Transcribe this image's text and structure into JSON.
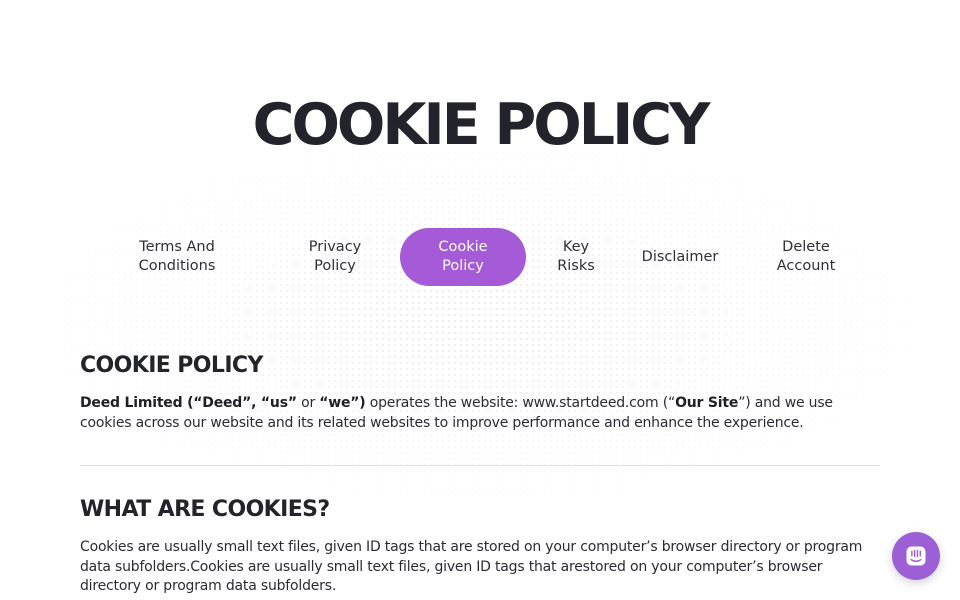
{
  "hero": {
    "title": "COOKIE POLICY"
  },
  "tabs": [
    {
      "label": "Terms And\nConditions",
      "active": false
    },
    {
      "label": "Privacy\nPolicy",
      "active": false
    },
    {
      "label": "Cookie\nPolicy",
      "active": true
    },
    {
      "label": "Key\nRisks",
      "active": false
    },
    {
      "label": "Disclaimer",
      "active": false
    },
    {
      "label": "Delete\nAccount",
      "active": false
    }
  ],
  "sections": {
    "cookie_policy": {
      "heading": "COOKIE POLICY",
      "company": "Deed Limited (“Deed”, “us”",
      "or_word": " or ",
      "we": "“we”)",
      "intro": " operates the website: www.startdeed.com (“",
      "our_site": "Our Site",
      "rest": "”) and we use cookies across our website and its related websites to improve performance and enhance the experience."
    },
    "what_are_cookies": {
      "heading": "WHAT ARE COOKIES?",
      "body": "Cookies are usually small text files, given ID tags that are stored on your computer’s browser directory or program data subfolders.Cookies are usually small text files, given ID tags that arestored on your computer’s browser directory or program data subfolders."
    }
  },
  "colors": {
    "accent": "#a55ad8",
    "chat_button": "#9d5fd6",
    "text": "#2b2b33"
  },
  "chat": {
    "icon": "chat-icon"
  }
}
